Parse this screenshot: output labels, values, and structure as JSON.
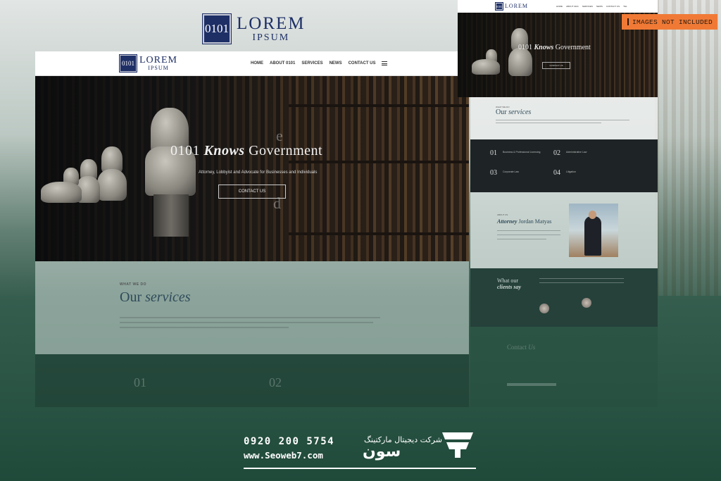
{
  "top_logo": {
    "mark": "0101",
    "line1": "LOREM",
    "line2": "IPSUM"
  },
  "badge": {
    "text": "IMAGES NOT INCLUDED"
  },
  "main": {
    "nav": {
      "logo_mark": "0101",
      "logo_line1": "LOREM",
      "logo_line2": "IPSUM",
      "items": [
        "HOME",
        "ABOUT 0101",
        "SERVICES",
        "NEWS",
        "CONTACT US"
      ]
    },
    "hero": {
      "title_pre": "0101 ",
      "title_em": "Knows",
      "title_post": " Government",
      "subtitle": "Attorney, Lobbyist and Advocate for Businesses and Individuals",
      "cta": "CONTACT US"
    },
    "services": {
      "eyebrow": "WHAT WE DO",
      "title_pre": "Our ",
      "title_em": "services"
    },
    "lower": {
      "n1": "01",
      "n2": "02"
    }
  },
  "right": {
    "nav": {
      "logo_mark": "0101",
      "logo_line1": "LOREM",
      "items": [
        "HOME",
        "ABOUT 0101",
        "SERVICES",
        "NEWS",
        "CONTACT US",
        "TEL"
      ]
    },
    "hero": {
      "title_pre": "0101 ",
      "title_em": "Knows",
      "title_post": " Government",
      "cta": "CONTACT US"
    },
    "services": {
      "eyebrow": "WHAT WE DO",
      "title_pre": "Our ",
      "title_em": "services"
    },
    "service_items": [
      {
        "num": "01",
        "label": "Business & Professional Licensing"
      },
      {
        "num": "02",
        "label": "Administrative Law"
      },
      {
        "num": "03",
        "label": "Corporate Law"
      },
      {
        "num": "04",
        "label": "Litigation"
      }
    ],
    "attorney": {
      "eyebrow": "ABOUT US",
      "title_em": "Attorney",
      "title_post": " Jordan Matyas"
    },
    "clients": {
      "line1": "What our",
      "line2": "clients say"
    },
    "contact": {
      "title_pre": "Contact ",
      "title_em": "Us"
    }
  },
  "footer": {
    "phone": "0920 200 5754",
    "url": "www.Seoweb7.com",
    "company_small": "شرکت دیجیتال مارکتینگ",
    "company_big": "سون"
  },
  "colors": {
    "accent": "#1e2f66",
    "badge": "#f07a35",
    "background": "#254a3c"
  }
}
